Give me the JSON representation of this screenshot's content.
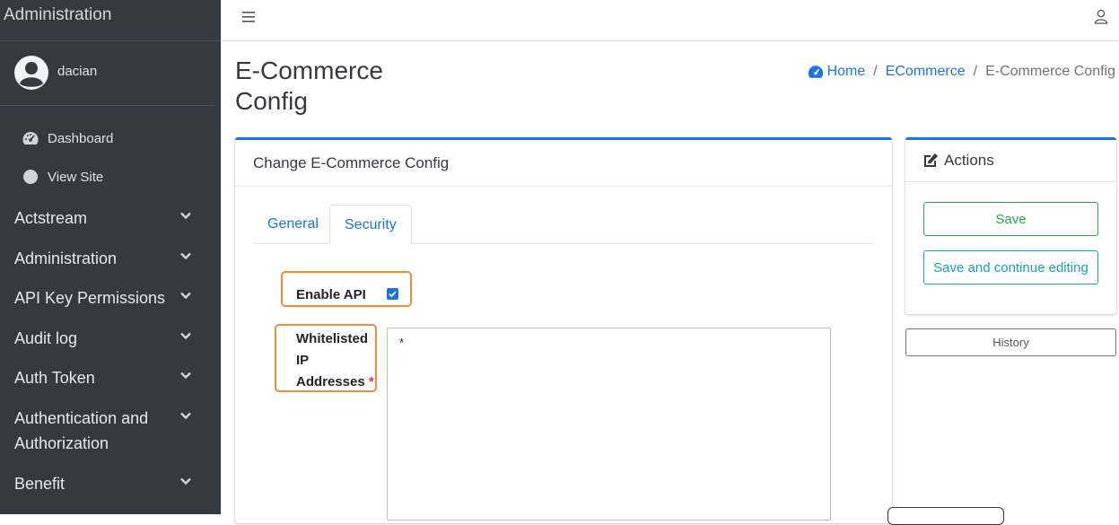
{
  "sidebar": {
    "brand": "Administration",
    "user_name": "dacian",
    "top_links": [
      {
        "label": "Dashboard",
        "icon": "tachometer-icon"
      },
      {
        "label": "View Site",
        "icon": "circle-icon"
      }
    ],
    "groups": [
      {
        "label": "Actstream"
      },
      {
        "label": "Administration"
      },
      {
        "label": "API Key Permissions"
      },
      {
        "label": "Audit log"
      },
      {
        "label": "Auth Token"
      },
      {
        "label": "Authentication and Authorization"
      },
      {
        "label": "Benefit"
      }
    ]
  },
  "header": {
    "menu_icon": "hamburger-icon",
    "user_icon": "user-icon"
  },
  "page": {
    "title": "E-Commerce Config",
    "breadcrumb": {
      "home": "Home",
      "section": "ECommerce",
      "current": "E-Commerce Config"
    }
  },
  "form": {
    "card_title": "Change E-Commerce Config",
    "tabs": [
      "General",
      "Security"
    ],
    "active_tab": "Security",
    "enable_api": {
      "label": "Enable API",
      "checked": true
    },
    "whitelisted": {
      "label_line1": "Whitelisted",
      "label_line2": "IP",
      "label_line3": "Addresses",
      "required_mark": "*",
      "value": "*"
    }
  },
  "actions": {
    "title": "Actions",
    "save": "Save",
    "save_continue": "Save and continue editing",
    "history": "History"
  },
  "colors": {
    "sidebar_bg": "#343a40",
    "primary": "#1a73e8",
    "success": "#28a745",
    "info": "#17a2b8",
    "highlight": "#f28c38"
  }
}
